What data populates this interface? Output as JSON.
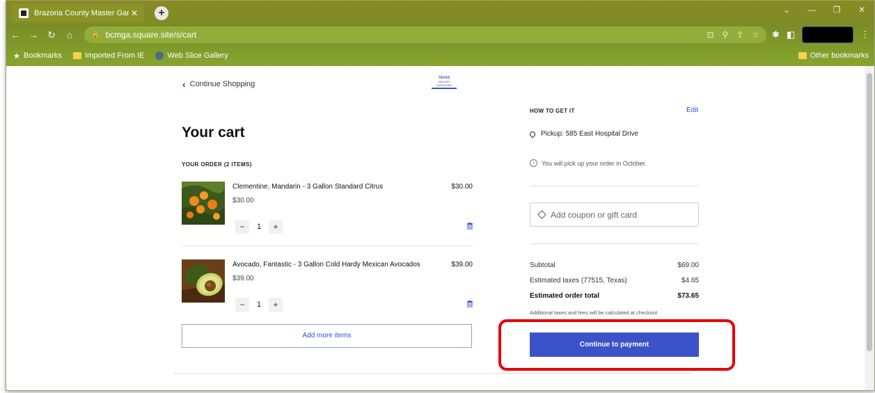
{
  "browser": {
    "tab_title": "Brazoria County Master Gardene",
    "url": "bcmga.square.site/s/cart",
    "bookmarks": [
      "Bookmarks",
      "Imported From IE",
      "Web Slice Gallery"
    ],
    "other_bookmarks": "Other bookmarks"
  },
  "nav": {
    "continue_shopping": "Continue Shopping"
  },
  "logo": {
    "line1": "TEXAS",
    "line2": "MASTER GARDENER"
  },
  "cart": {
    "title": "Your cart",
    "order_heading": "YOUR ORDER (2 ITEMS)",
    "items": [
      {
        "name": "Clementine, Mandarin - 3 Gallon Standard Citrus",
        "unit_price": "$30.00",
        "line_total": "$30.00",
        "quantity": "1"
      },
      {
        "name": "Avocado, Fantastic - 3 Gallon Cold Hardy Mexican Avocados",
        "unit_price": "$39.00",
        "line_total": "$39.00",
        "quantity": "1"
      }
    ],
    "add_more": "Add more items"
  },
  "fulfillment": {
    "heading": "HOW TO GET IT",
    "edit": "Edit",
    "pickup": "Pickup: 585 East Hospital Drive",
    "note": "You will pick up your order in October."
  },
  "coupon": {
    "placeholder": "Add coupon or gift card"
  },
  "summary": {
    "subtotal_label": "Subtotal",
    "subtotal": "$69.00",
    "tax_label": "Estimated taxes (77515, Texas)",
    "tax": "$4.65",
    "total_label": "Estimated order total",
    "total": "$73.65",
    "fine_print": "Additional taxes and fees will be calculated at checkout"
  },
  "checkout": {
    "button": "Continue to payment"
  },
  "colors": {
    "accent": "#3b52c9",
    "highlight": "#e60000",
    "chrome": "#7f9a2a"
  }
}
